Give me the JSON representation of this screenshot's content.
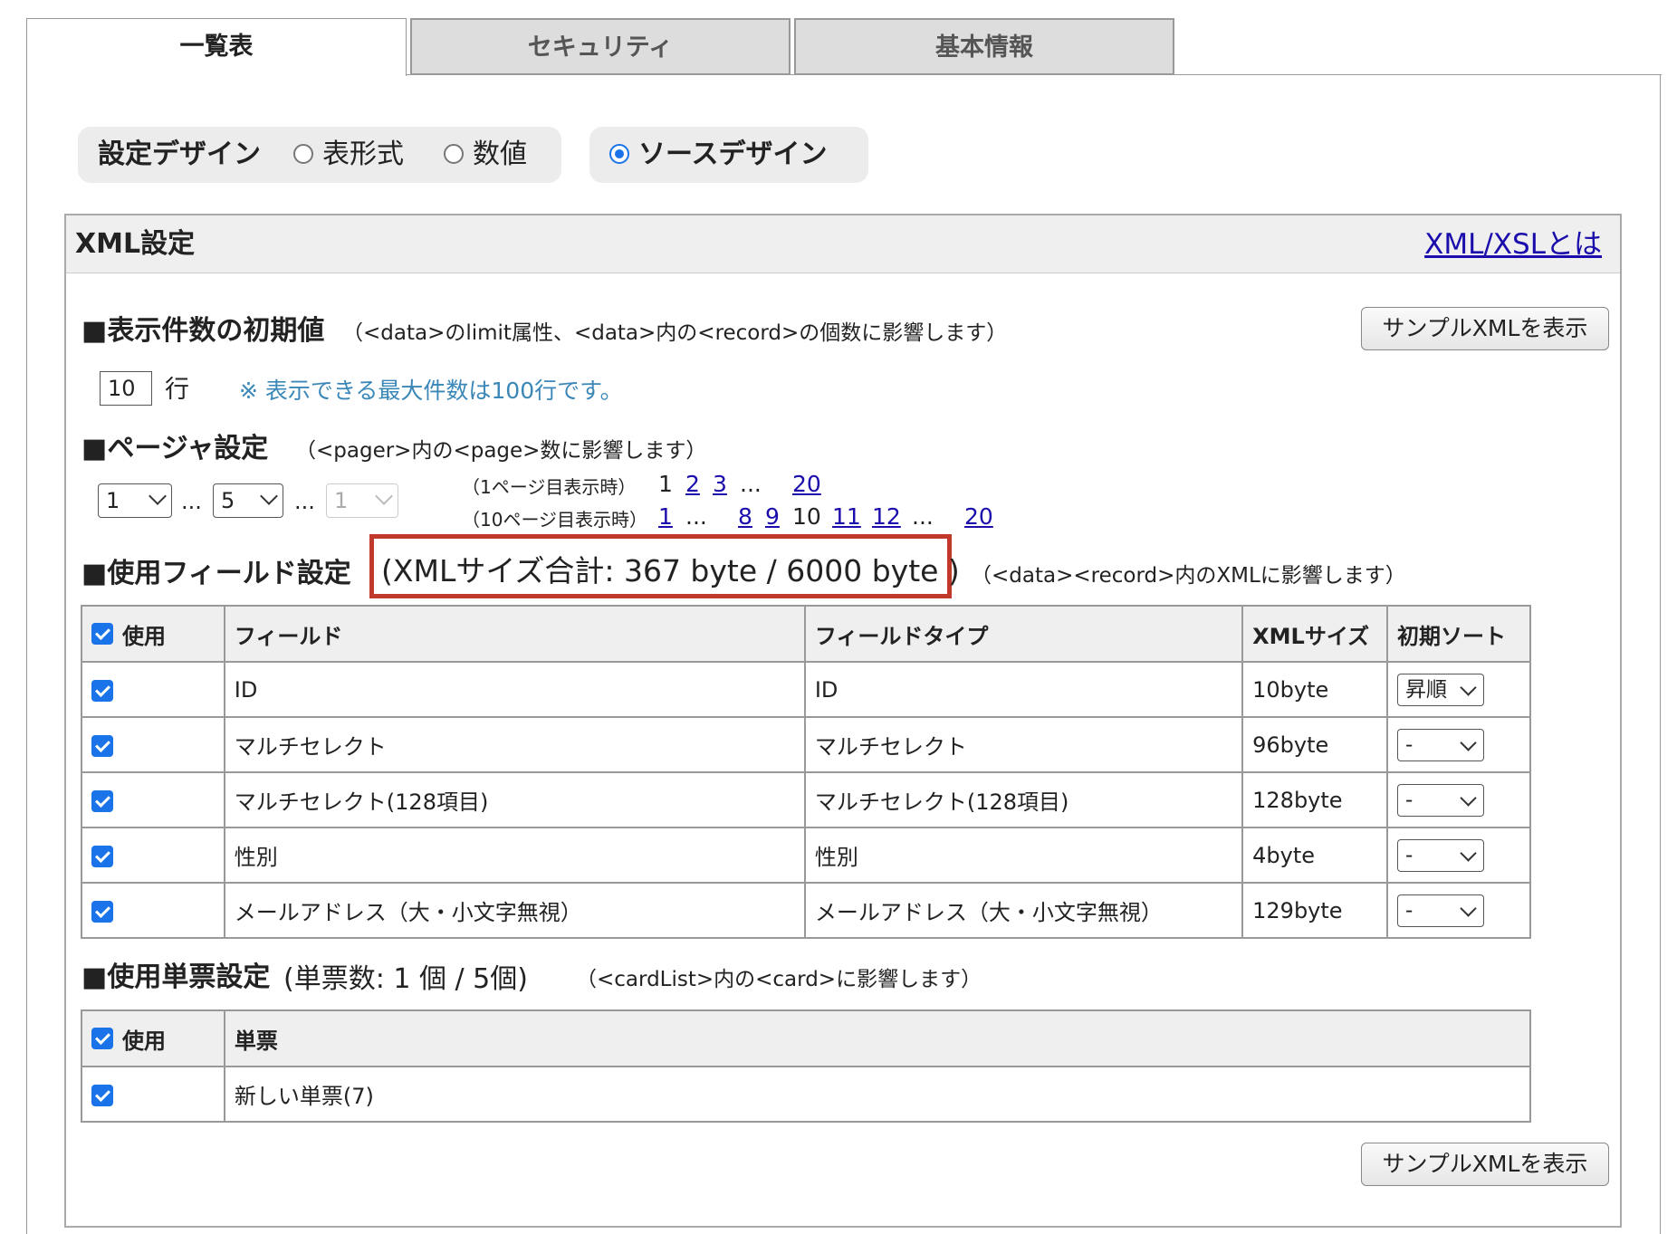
{
  "tabs": [
    {
      "label": "一覧表",
      "active": true
    },
    {
      "label": "セキュリティ",
      "active": false
    },
    {
      "label": "基本情報",
      "active": false
    }
  ],
  "design": {
    "label": "設定デザイン",
    "options": [
      "表形式",
      "数値"
    ],
    "source_label": "ソースデザイン",
    "selected": "ソースデザイン"
  },
  "panel": {
    "title": "XML設定",
    "link": "XML/XSLとは"
  },
  "display_count": {
    "title": "■表示件数の初期値",
    "note": "（<data>のlimit属性、<data>内の<record>の個数に影響します）",
    "sample_button": "サンプルXMLを表示",
    "value": "10",
    "unit": "行",
    "hint": "※ 表示できる最大件数は100行です。"
  },
  "pager": {
    "title": "■ページャ設定",
    "note": "（<pager>内の<page>数に影響します）",
    "select1": "1",
    "select2": "5",
    "select3": "1",
    "ellipsis": "...",
    "example1_label": "（1ページ目表示時）",
    "example1": [
      {
        "t": "1",
        "link": false
      },
      {
        "t": "2",
        "link": true
      },
      {
        "t": "3",
        "link": true
      },
      {
        "t": "...",
        "link": false
      },
      {
        "t": "20",
        "link": true
      }
    ],
    "example2_label": "（10ページ目表示時）",
    "example2": [
      {
        "t": "1",
        "link": true
      },
      {
        "t": "...",
        "link": false
      },
      {
        "t": "8",
        "link": true
      },
      {
        "t": "9",
        "link": true
      },
      {
        "t": "10",
        "link": false
      },
      {
        "t": "11",
        "link": true
      },
      {
        "t": "12",
        "link": true
      },
      {
        "t": "...",
        "link": false
      },
      {
        "t": "20",
        "link": true
      }
    ]
  },
  "fields": {
    "title": "■使用フィールド設定",
    "size_text": "(XMLサイズ合計: 367 byte / 6000 byte )",
    "note": "（<data><record>内のXMLに影響します）",
    "headers": [
      "使用",
      "フィールド",
      "フィールドタイプ",
      "XMLサイズ",
      "初期ソート"
    ],
    "rows": [
      {
        "field": "ID",
        "type": "ID",
        "size": "10byte",
        "sort": "昇順"
      },
      {
        "field": "マルチセレクト",
        "type": "マルチセレクト",
        "size": "96byte",
        "sort": "-"
      },
      {
        "field": "マルチセレクト(128項目)",
        "type": "マルチセレクト(128項目)",
        "size": "128byte",
        "sort": "-"
      },
      {
        "field": "性別",
        "type": "性別",
        "size": "4byte",
        "sort": "-"
      },
      {
        "field": "メールアドレス（大・小文字無視）",
        "type": "メールアドレス（大・小文字無視）",
        "size": "129byte",
        "sort": "-"
      }
    ]
  },
  "cards": {
    "title": "■使用単票設定",
    "count_text": "(単票数: 1 個 / 5個)",
    "note": "（<cardList>内の<card>に影響します）",
    "headers": [
      "使用",
      "単票"
    ],
    "rows": [
      {
        "name": "新しい単票(7)"
      }
    ],
    "sample_button": "サンプルXMLを表示"
  }
}
